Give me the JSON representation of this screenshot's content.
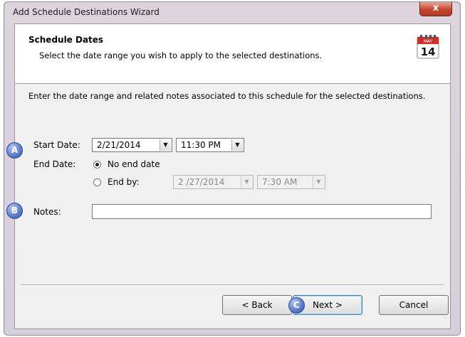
{
  "window": {
    "title": "Add Schedule Destinations Wizard",
    "close_glyph": "x"
  },
  "header": {
    "title": "Schedule Dates",
    "subtitle": "Select the date range you wish to apply to the selected destinations.",
    "calendar_month": "MAY",
    "calendar_day": "14"
  },
  "instructions": "Enter the date range and related notes associated to this schedule for the selected destinations.",
  "form": {
    "start_date_label": "Start Date:",
    "start_date_value": "2/21/2014",
    "start_time_value": "11:30 PM",
    "end_date_label": "End Date:",
    "no_end_date_label": "No end date",
    "end_by_label": "End by:",
    "end_by_date_value": "2 /27/2014",
    "end_by_time_value": "7:30 AM",
    "end_option_selected": "No end date",
    "notes_label": "Notes:",
    "notes_value": ""
  },
  "buttons": {
    "back": "< Back",
    "next": "Next >",
    "cancel": "Cancel"
  },
  "callouts": {
    "a": "A",
    "b": "B",
    "c": "C"
  },
  "colors": {
    "callout": "#4f6fc2",
    "close_button": "#c5452f",
    "window_frame": "#d8d0dc"
  },
  "icons": [
    "close-icon",
    "calendar-icon",
    "chevron-down-icon"
  ]
}
